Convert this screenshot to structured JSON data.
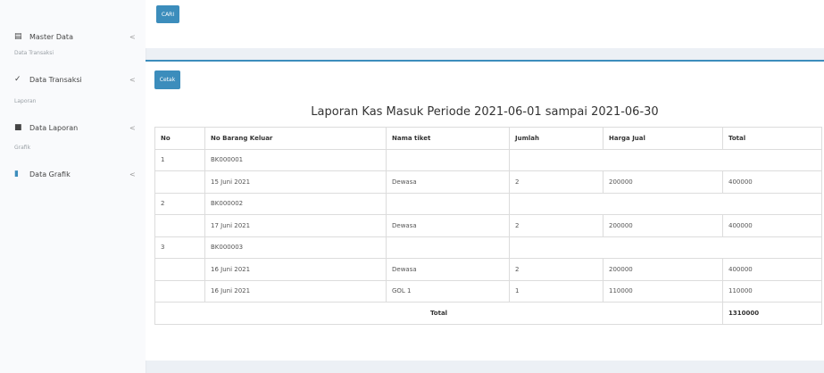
{
  "sidebar": {
    "items": [
      {
        "label": "Master Data",
        "icon": "database-icon",
        "chevron": "<"
      },
      {
        "label": "Data Transaksi",
        "icon": "cart-icon",
        "chevron": "<"
      },
      {
        "label": "Data Laporan",
        "icon": "book-icon",
        "chevron": "<"
      },
      {
        "label": "Data Grafik",
        "icon": "bar-chart-icon",
        "chevron": "<"
      }
    ],
    "headers": [
      "Data Transaksi",
      "Laporan",
      "Grafik"
    ]
  },
  "toolbar": {
    "search_label": "CARI"
  },
  "report": {
    "print_label": "Cetak",
    "title": "Laporan Kas Masuk Periode 2021-06-01 sampai 2021-06-30",
    "columns": [
      "No",
      "No Barang Keluar",
      "Nama tiket",
      "Jumlah",
      "Harga Jual",
      "Total"
    ],
    "rows": [
      [
        "1",
        "BK000001",
        "",
        "",
        "",
        ""
      ],
      [
        "",
        "15 Juni 2021",
        "Dewasa",
        "2",
        "200000",
        "400000"
      ],
      [
        "2",
        "BK000002",
        "",
        "",
        "",
        ""
      ],
      [
        "",
        "17 Juni 2021",
        "Dewasa",
        "2",
        "200000",
        "400000"
      ],
      [
        "3",
        "BK000003",
        "",
        "",
        "",
        ""
      ],
      [
        "",
        "16 Juni 2021",
        "Dewasa",
        "2",
        "200000",
        "400000"
      ],
      [
        "",
        "16 Juni 2021",
        "GOL 1",
        "1",
        "110000",
        "110000"
      ]
    ],
    "total_label": "Total",
    "total_value": "1310000"
  },
  "colors": {
    "accent": "#3c8dbc"
  }
}
